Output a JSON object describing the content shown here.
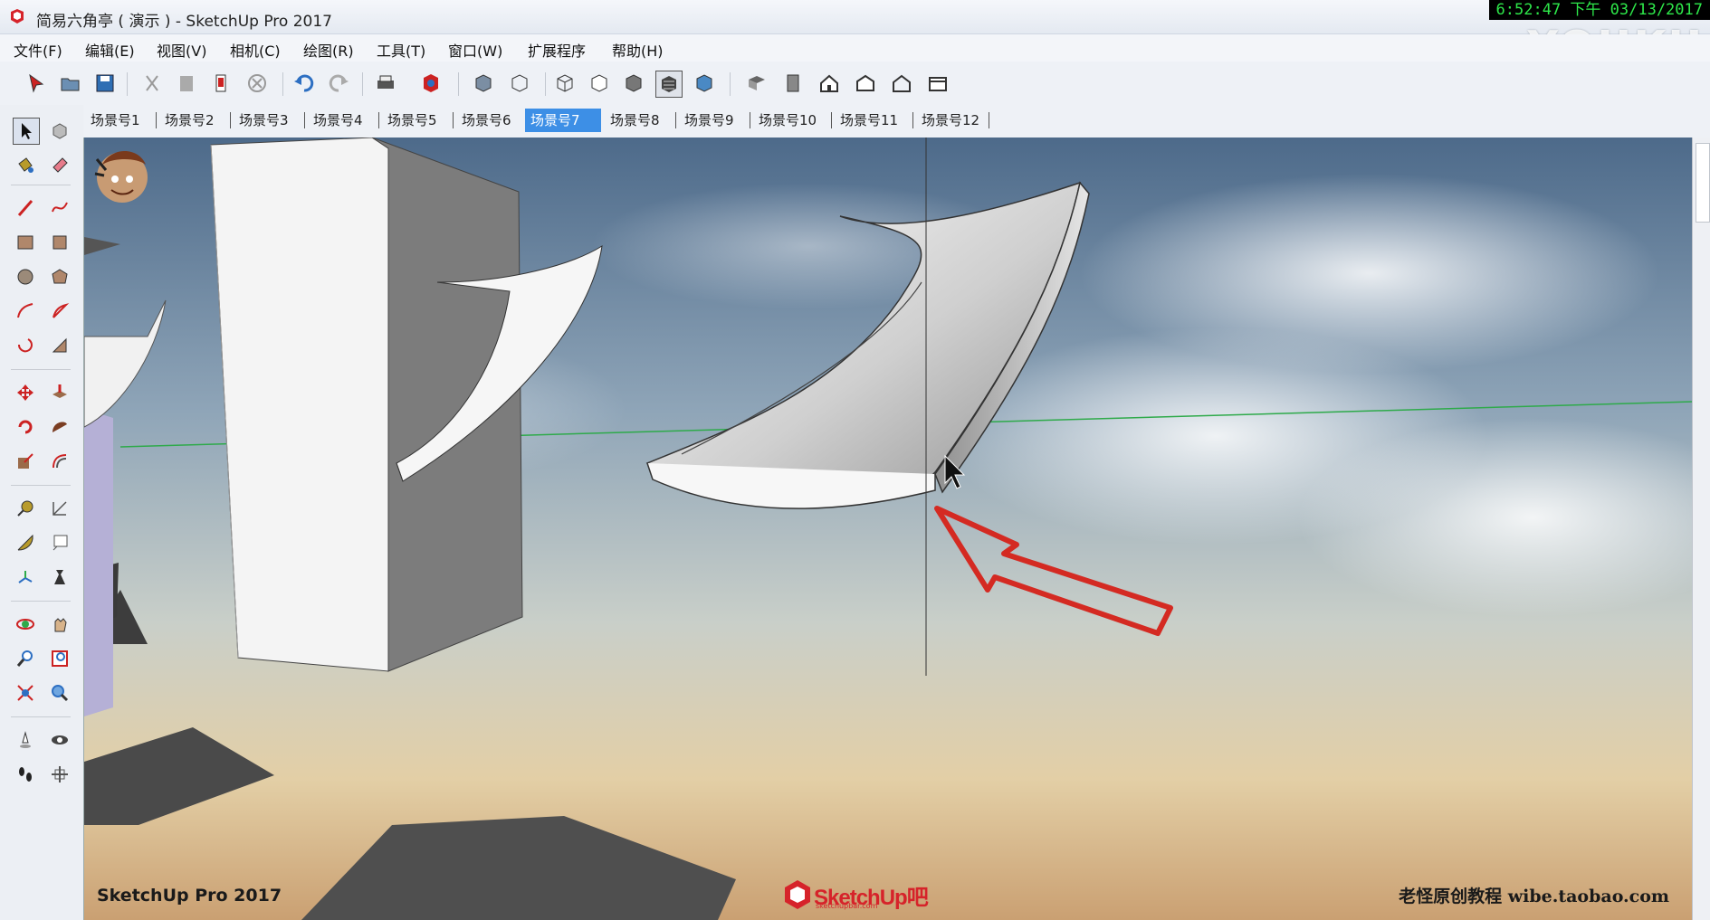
{
  "window": {
    "title": "简易六角亭 ( 演示 ) - SketchUp Pro 2017",
    "clock": "6:52:47 下午 03/13/2017",
    "watermark": "YOUKU"
  },
  "menu": [
    "文件(F)",
    "编辑(E)",
    "视图(V)",
    "相机(C)",
    "绘图(R)",
    "工具(T)",
    "窗口(W)",
    "扩展程序",
    "帮助(H)"
  ],
  "scene_tabs": {
    "items": [
      "场景号1",
      "场景号2",
      "场景号3",
      "场景号4",
      "场景号5",
      "场景号6",
      "场景号7",
      "场景号8",
      "场景号9",
      "场景号10",
      "场景号11",
      "场景号12"
    ],
    "active": "场景号7"
  },
  "viewport": {
    "app_label": "SketchUp Pro 2017",
    "logo_text": "SketchUp吧",
    "logo_sub": "sketchupbar.com",
    "course_label": "老怪原创教程  wibe.taobao.com"
  },
  "colors": {
    "accent": "#3d8fe6",
    "annotation_arrow": "#d42a22",
    "green_axis": "#2eaa4a"
  },
  "top_tools": [
    "select-icon",
    "open-icon",
    "save-icon",
    "cut-icon",
    "paste-icon",
    "erase-icon",
    "delete-icon",
    "undo-icon",
    "redo-icon",
    "print-icon",
    "model-info-icon",
    "xray-icon",
    "back-edges-icon",
    "wireframe-icon",
    "hidden-line-icon",
    "shaded-icon",
    "shaded-textures-icon",
    "monochrome-icon",
    "iso-view-icon",
    "top-view-icon",
    "front-view-icon",
    "right-view-icon",
    "back-view-icon",
    "left-view-icon"
  ],
  "left_tools": [
    "select-icon",
    "component-icon",
    "paint-bucket-icon",
    "eraser-icon",
    "line-icon",
    "freehand-icon",
    "rectangle-icon",
    "rotated-rectangle-icon",
    "circle-icon",
    "polygon-icon",
    "arc-icon",
    "pie-icon",
    "three-point-arc-icon",
    "two-point-arc-icon",
    "move-icon",
    "push-pull-icon",
    "rotate-icon",
    "follow-me-icon",
    "scale-icon",
    "offset-icon",
    "tape-measure-icon",
    "dimension-icon",
    "protractor-icon",
    "text-icon",
    "axes-icon",
    "3d-text-icon",
    "orbit-icon",
    "pan-icon",
    "zoom-icon",
    "zoom-window-icon",
    "zoom-extents-icon",
    "previous-view-icon",
    "position-camera-icon",
    "look-around-icon",
    "walk-icon",
    "section-plane-icon"
  ]
}
